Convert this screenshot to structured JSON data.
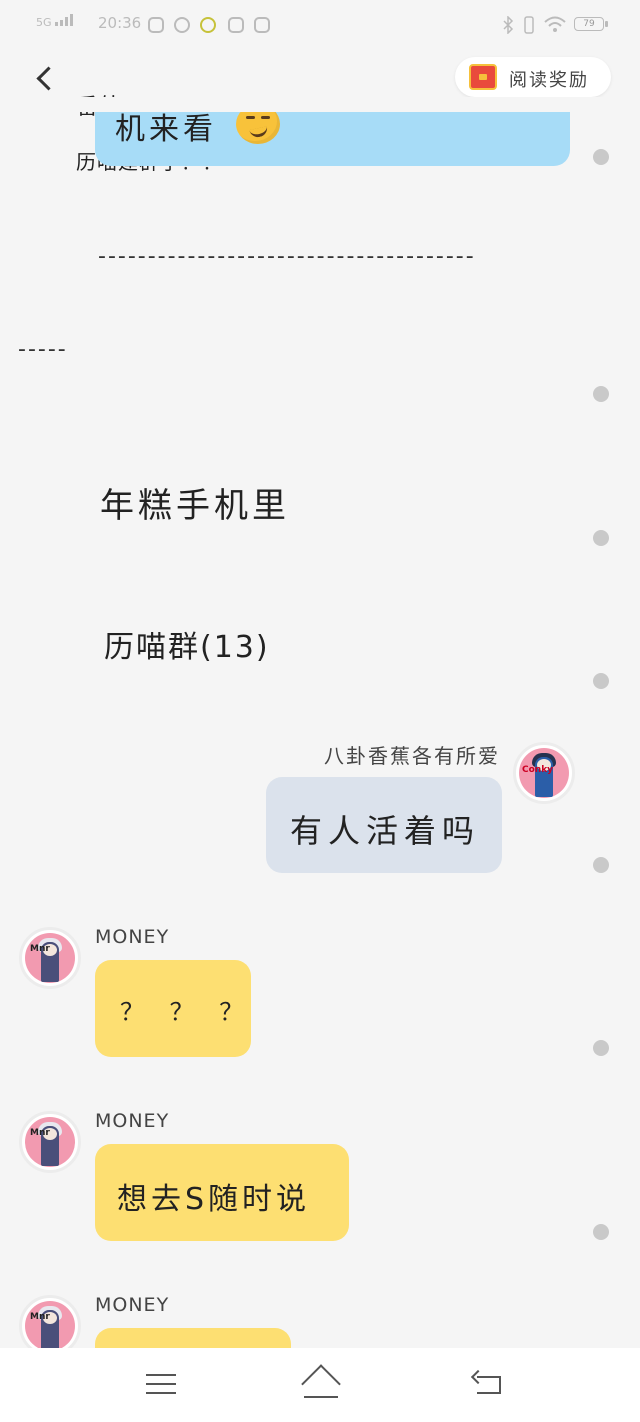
{
  "status_bar": {
    "network": "5G",
    "time": "20:36",
    "battery": "79"
  },
  "header": {
    "title_part1": "番外",
    "title_part2": "历喵建群了？！",
    "reward_label": "阅读奖励"
  },
  "messages": {
    "blue_bubble_text": "机来看",
    "divider_long": "--------------------------------------",
    "divider_short": "-----",
    "plain_1": "年糕手机里",
    "plain_2": "历喵群(13)",
    "right_sender": "八卦香蕉各有所爱",
    "right_text": "有人活着吗",
    "left_sender_1": "MONEY",
    "left_text_1": "？ ？ ？",
    "left_sender_2": "MONEY",
    "left_text_2": "想去S随时说",
    "left_sender_3": "MONEY",
    "avatar_right_label": "Conky",
    "avatar_left_label": "Mnr"
  },
  "icons": {
    "back": "chevron-left-icon",
    "reward": "treasure-chest-icon",
    "emoji": "smirk-emoji-icon",
    "nav_menu": "menu-icon",
    "nav_home": "home-icon",
    "nav_back": "back-icon"
  },
  "colors": {
    "bubble_blue": "#a7dcf7",
    "bubble_yellow": "#fddf72",
    "bubble_gray": "#dbe2ec",
    "background": "#f5f5f5"
  }
}
